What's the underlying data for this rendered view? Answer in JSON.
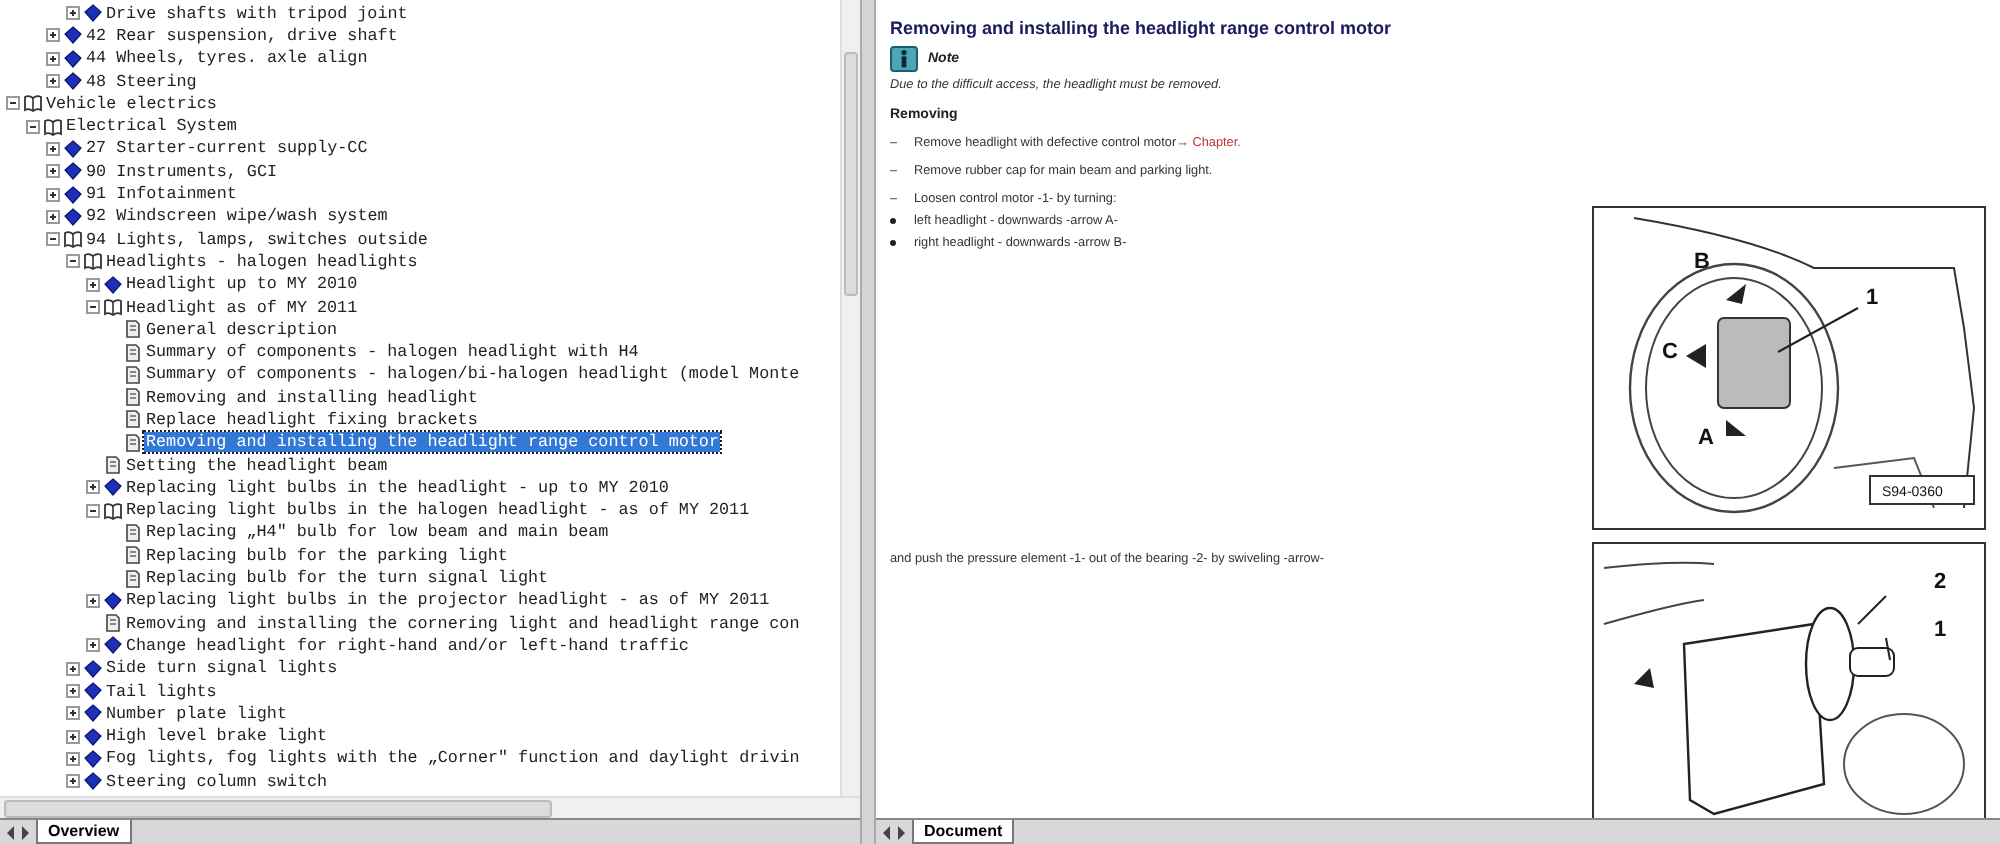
{
  "tree": [
    {
      "children": [
        {
          "children": [
            {
              "children": [
                {
                  "label": "Drive shafts with tripod joint",
                  "kind": "book",
                  "expanded": false,
                  "selected": false
                }
              ]
            },
            {
              "label": "42 Rear suspension, drive shaft",
              "kind": "book",
              "expanded": false,
              "selected": false
            },
            {
              "label": "44 Wheels, tyres. axle align",
              "kind": "book",
              "expanded": false,
              "selected": false
            },
            {
              "label": "48 Steering",
              "kind": "book",
              "expanded": false,
              "selected": false
            }
          ]
        }
      ]
    },
    {
      "label": "Vehicle electrics",
      "kind": "book",
      "expanded": true,
      "selected": false,
      "children": [
        {
          "label": "Electrical System",
          "kind": "book",
          "expanded": true,
          "selected": false,
          "children": [
            {
              "label": "27 Starter-current supply-CC",
              "kind": "book",
              "expanded": false,
              "selected": false
            },
            {
              "label": "90 Instruments, GCI",
              "kind": "book",
              "expanded": false,
              "selected": false
            },
            {
              "label": "91 Infotainment",
              "kind": "book",
              "expanded": false,
              "selected": false
            },
            {
              "label": "92 Windscreen wipe/wash system",
              "kind": "book",
              "expanded": false,
              "selected": false
            },
            {
              "label": "94 Lights, lamps, switches outside",
              "kind": "book",
              "expanded": true,
              "selected": false,
              "children": [
                {
                  "label": "Headlights - halogen headlights",
                  "kind": "book",
                  "expanded": true,
                  "selected": false,
                  "children": [
                    {
                      "label": "Headlight up to MY 2010",
                      "kind": "book",
                      "expanded": false,
                      "selected": false
                    },
                    {
                      "label": "Headlight as of MY 2011",
                      "kind": "book",
                      "expanded": true,
                      "selected": false,
                      "children": [
                        {
                          "label": "General description",
                          "kind": "page",
                          "selected": false
                        },
                        {
                          "label": "Summary of components - halogen headlight with H4",
                          "kind": "page",
                          "selected": false
                        },
                        {
                          "label": "Summary of components - halogen/bi-halogen headlight (model Monte",
                          "kind": "page",
                          "selected": false
                        },
                        {
                          "label": "Removing and installing headlight",
                          "kind": "page",
                          "selected": false
                        },
                        {
                          "label": "Replace headlight fixing brackets",
                          "kind": "page",
                          "selected": false
                        },
                        {
                          "label": "Removing and installing the headlight range control motor",
                          "kind": "page",
                          "selected": true
                        }
                      ]
                    },
                    {
                      "label": "Setting the headlight beam",
                      "kind": "page",
                      "selected": false
                    },
                    {
                      "label": "Replacing light bulbs in the headlight - up to MY 2010",
                      "kind": "book",
                      "expanded": false,
                      "selected": false
                    },
                    {
                      "label": "Replacing light bulbs in the halogen headlight - as of MY 2011",
                      "kind": "book",
                      "expanded": true,
                      "selected": false,
                      "children": [
                        {
                          "label": "Replacing „H4\" bulb for low beam and main beam",
                          "kind": "page",
                          "selected": false
                        },
                        {
                          "label": "Replacing bulb for the parking light",
                          "kind": "page",
                          "selected": false
                        },
                        {
                          "label": "Replacing bulb for the turn signal light",
                          "kind": "page",
                          "selected": false
                        }
                      ]
                    },
                    {
                      "label": "Replacing light bulbs in the projector headlight - as of MY 2011",
                      "kind": "book",
                      "expanded": false,
                      "selected": false
                    },
                    {
                      "label": "Removing and installing the cornering light and headlight range con",
                      "kind": "page",
                      "selected": false
                    },
                    {
                      "label": "Change headlight for right-hand and/or left-hand traffic",
                      "kind": "book",
                      "expanded": false,
                      "selected": false
                    }
                  ]
                },
                {
                  "label": "Side turn signal lights",
                  "kind": "book",
                  "expanded": false,
                  "selected": false
                },
                {
                  "label": "Tail lights",
                  "kind": "book",
                  "expanded": false,
                  "selected": false
                },
                {
                  "label": "Number plate light",
                  "kind": "book",
                  "expanded": false,
                  "selected": false
                },
                {
                  "label": "High level brake light",
                  "kind": "book",
                  "expanded": false,
                  "selected": false
                },
                {
                  "label": "Fog lights, fog lights with the „Corner\" function and daylight drivin",
                  "kind": "book",
                  "expanded": false,
                  "selected": false
                },
                {
                  "label": "Steering column switch",
                  "kind": "book",
                  "expanded": false,
                  "selected": false
                }
              ]
            }
          ]
        }
      ]
    }
  ],
  "left_tabs": [
    {
      "label": "Overview",
      "selected": true
    }
  ],
  "document": {
    "title": "Removing and installing the headlight range control motor",
    "note_label": "Note",
    "note_text": "Due to the difficult access, the headlight must be removed.",
    "heading": "Removing",
    "steps": [
      {
        "marker": "–",
        "text": "Remove headlight with defective control motor",
        "link": "→ Chapter."
      },
      {
        "marker": "–",
        "text": "Remove rubber cap for main beam and parking light."
      },
      {
        "marker": "–",
        "text": "Loosen control motor -1- by turning:"
      }
    ],
    "bullets": [
      "left headlight - downwards -arrow A-",
      "right headlight - downwards -arrow B-"
    ],
    "figure_1": {
      "labels": [
        "B",
        "C",
        "A",
        "1"
      ],
      "code": "S94-0360"
    },
    "paragraph": "and push the pressure element -1- out of the bearing -2- by swiveling -arrow-",
    "figure_2": {
      "labels": [
        "2",
        "1"
      ]
    }
  },
  "right_tabs": [
    {
      "label": "Document",
      "selected": true
    }
  ]
}
